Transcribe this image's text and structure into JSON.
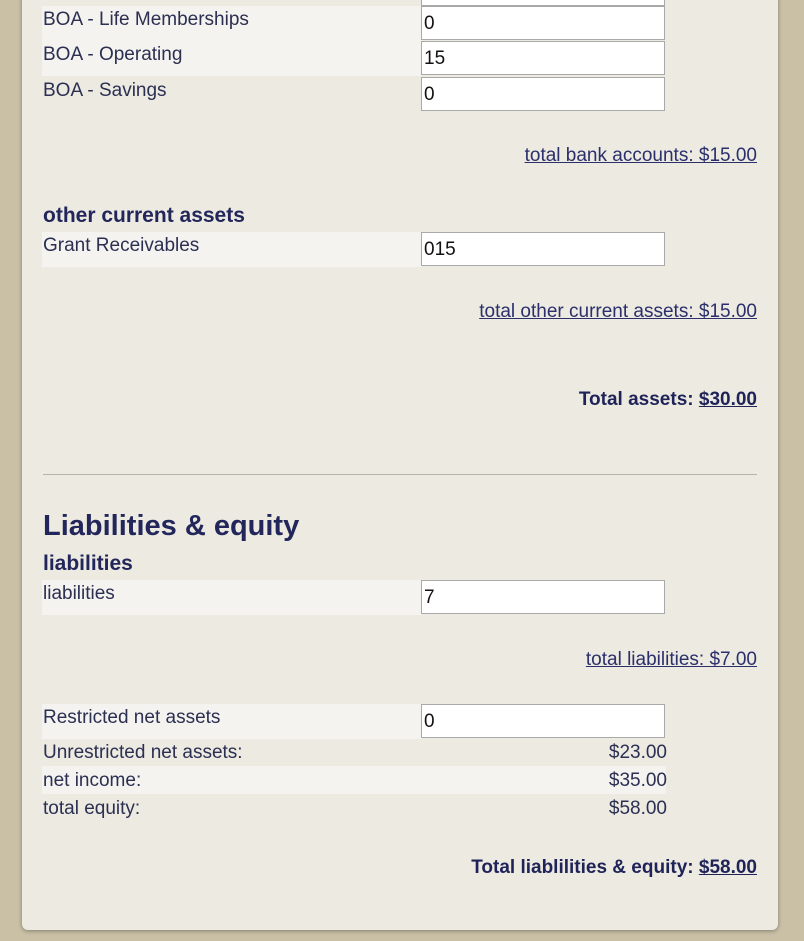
{
  "assets": {
    "bank_accounts": [
      {
        "label": "BOA - Life Memberships",
        "value": "0"
      },
      {
        "label": "BOA - Operating",
        "value": "15"
      },
      {
        "label": "BOA - Savings",
        "value": "0"
      }
    ],
    "total_bank_accounts": "total bank accounts: $15.00",
    "other_current_assets_heading": "other current assets",
    "other_current_assets": [
      {
        "label": "Grant Receivables",
        "value": "015"
      }
    ],
    "total_other_current_assets": "total other current assets: $15.00",
    "total_assets_label": "Total assets:",
    "total_assets_value": "$30.00"
  },
  "liabilities_equity": {
    "heading": "Liabilities & equity",
    "liabilities_heading": "liabilities",
    "liabilities": [
      {
        "label": "liabilities",
        "value": "7"
      }
    ],
    "total_liabilities": "total liabilities: $7.00",
    "restricted_net_assets": {
      "label": "Restricted net assets",
      "value": "0"
    },
    "unrestricted_net_assets": {
      "label": "Unrestricted net assets:",
      "value": "$23.00"
    },
    "net_income": {
      "label": "net income:",
      "value": "$35.00"
    },
    "total_equity": {
      "label": "total equity:",
      "value": "$58.00"
    },
    "total_label": "Total liablilities & equity:",
    "total_value": "$58.00"
  }
}
